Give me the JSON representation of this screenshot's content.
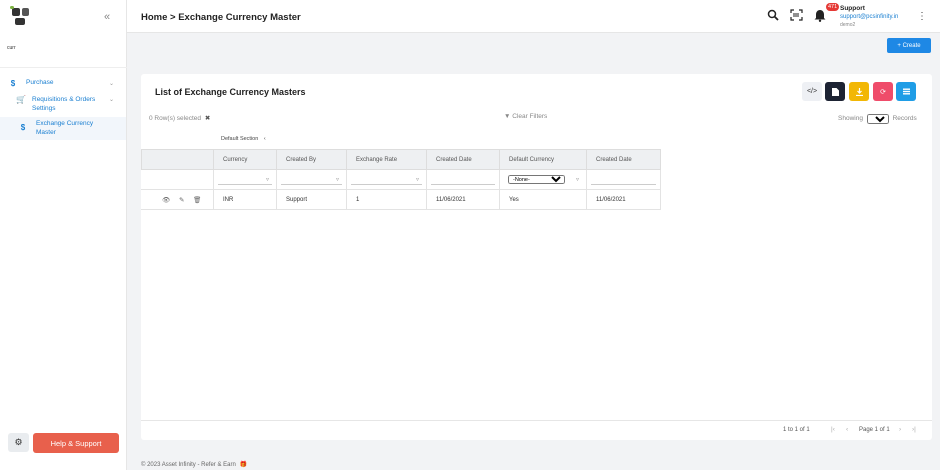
{
  "sidebar": {
    "org_label": "curr",
    "items": [
      {
        "label": "Purchase",
        "icon": "dollar-icon"
      },
      {
        "label": "Requisitions & Orders Settings",
        "icon": "cart-icon"
      },
      {
        "label": "Exchange Currency Master",
        "icon": "dollar-icon"
      }
    ],
    "help_label": "Help & Support"
  },
  "topbar": {
    "breadcrumb": "Home > Exchange Currency Master",
    "notification_count": "471",
    "user_name": "Support",
    "user_email": "support@pcsinfinity.in",
    "user_sub": "demo2"
  },
  "create_label": "+ Create",
  "list": {
    "title": "List of Exchange Currency Masters",
    "selected_text": "0  Row(s) selected",
    "clear_filters": "Clear Filters",
    "showing_label": "Showing",
    "page_size": "100",
    "records_label": "Records",
    "section_label": "Default Section",
    "columns": [
      "Currency",
      "Created By",
      "Exchange Rate",
      "Created Date",
      "Default Currency",
      "Created Date"
    ],
    "filter_default_currency": "-None-",
    "rows": [
      [
        "INR",
        "Support",
        "1",
        "11/06/2021",
        "Yes",
        "11/06/2021"
      ]
    ],
    "pager_count": "1 to 1 of 1",
    "pager_page": "Page 1 of 1"
  },
  "footer": "© 2023  Asset Infinity - Refer & Earn",
  "colors": {
    "accent": "#1e88e5",
    "nav": "#1a7fd1",
    "help": "#e8604c",
    "btn_dark": "#1d2333",
    "btn_yellow": "#f2b705",
    "btn_red": "#ef4c6a",
    "btn_blue": "#1f9de6"
  }
}
